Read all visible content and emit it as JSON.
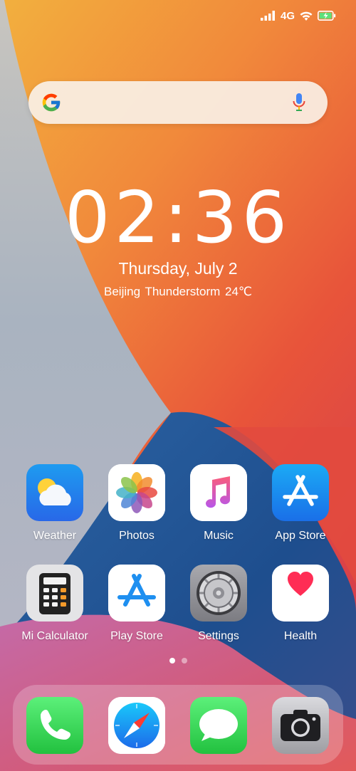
{
  "status_bar": {
    "network": "4G",
    "icons": [
      "signal-icon",
      "wifi-icon",
      "battery-charging-icon"
    ]
  },
  "search": {
    "logo": "google-logo-icon",
    "voice": "microphone-icon"
  },
  "lock": {
    "time": "02:36",
    "date": "Thursday, July 2",
    "weather": "Beijing  Thunderstorm  24℃"
  },
  "apps": {
    "weather": "Weather",
    "photos": "Photos",
    "music": "Music",
    "app_store": "App Store",
    "calculator": "Mi Calculator",
    "play_store": "Play Store",
    "settings": "Settings",
    "health": "Health"
  },
  "pages": {
    "count": 2,
    "current": 1
  },
  "dock": [
    "phone-icon",
    "safari-icon",
    "messages-icon",
    "camera-icon"
  ],
  "colors": {
    "wallpaper_orange": "#F39A3A",
    "wallpaper_red": "#E7453C",
    "wallpaper_blue": "#2A5C96",
    "wallpaper_grey": "#B7C1CC"
  }
}
